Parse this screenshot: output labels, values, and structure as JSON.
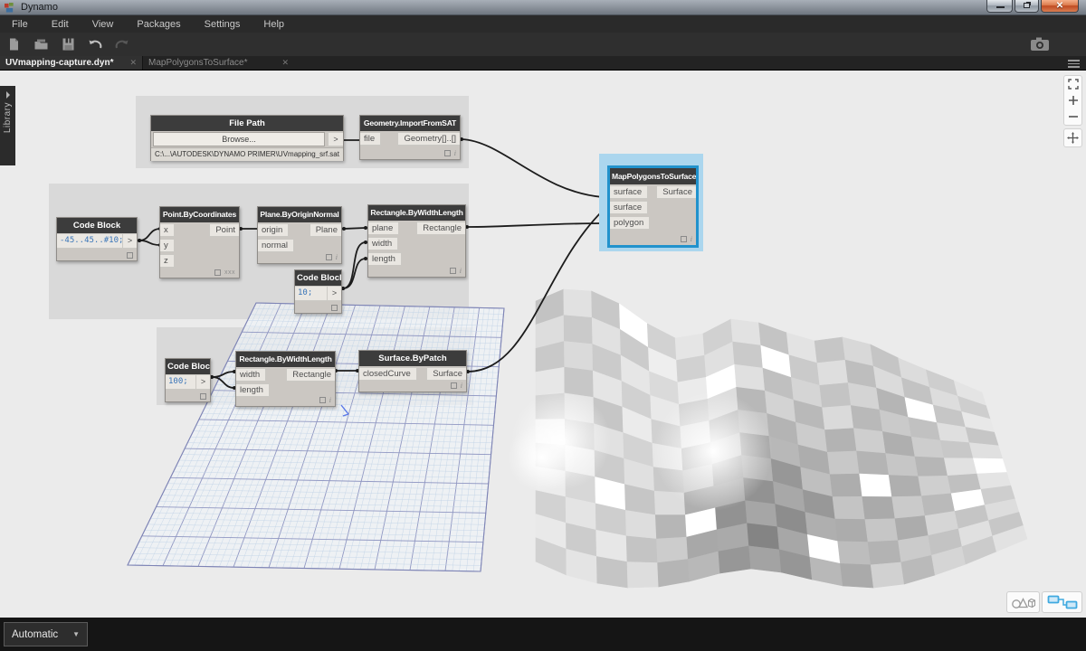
{
  "window": {
    "title": "Dynamo"
  },
  "menu": {
    "items": [
      "File",
      "Edit",
      "View",
      "Packages",
      "Settings",
      "Help"
    ]
  },
  "toolbar": {
    "icons": [
      "new-file",
      "open-file",
      "save",
      "undo",
      "redo"
    ],
    "right_icon": "screenshot-camera"
  },
  "tabs": [
    {
      "label": "UVmapping-capture.dyn*",
      "active": true
    },
    {
      "label": "MapPolygonsToSurface*",
      "active": false
    }
  ],
  "icons": {
    "close": "✕",
    "caret_down": "▼",
    "output_arrow": ">",
    "info": "i"
  },
  "library": {
    "label": "Library"
  },
  "footer": {
    "run_mode": "Automatic"
  },
  "canvas": {
    "nodes": [
      {
        "title": "File Path",
        "button": "Browse...",
        "output": ">",
        "path": "C:\\...\\AUTODESK\\DYNAMO PRIMER\\UVmapping_srf.sat"
      },
      {
        "title": "Geometry.ImportFromSAT",
        "inputs": [
          "file"
        ],
        "outputs": [
          "Geometry[]..[]"
        ]
      },
      {
        "title": "Code Block",
        "code": "-45..45..#10;",
        "output": ">"
      },
      {
        "title": "Point.ByCoordinates",
        "inputs": [
          "x",
          "y",
          "z"
        ],
        "outputs": [
          "Point"
        ],
        "lacing": "xxx"
      },
      {
        "title": "Plane.ByOriginNormal",
        "inputs": [
          "origin",
          "normal"
        ],
        "outputs": [
          "Plane"
        ]
      },
      {
        "title": "Rectangle.ByWidthLength",
        "inputs": [
          "plane",
          "width",
          "length"
        ],
        "outputs": [
          "Rectangle"
        ]
      },
      {
        "title": "Code Block",
        "code": "10;",
        "output": ">"
      },
      {
        "title": "Code Block",
        "code": "100;",
        "output": ">"
      },
      {
        "title": "Rectangle.ByWidthLength",
        "inputs": [
          "width",
          "length"
        ],
        "outputs": [
          "Rectangle"
        ]
      },
      {
        "title": "Surface.ByPatch",
        "inputs": [
          "closedCurve"
        ],
        "outputs": [
          "Surface"
        ]
      },
      {
        "title": "MapPolygonsToSurface",
        "inputs": [
          "surface",
          "surface",
          "polygon"
        ],
        "outputs": [
          "Surface"
        ],
        "selected": true
      }
    ],
    "connections": [
      {
        "from": "File Path.>",
        "to": "Geometry.ImportFromSAT.file"
      },
      {
        "from": "Geometry.ImportFromSAT.Geometry[]..[]",
        "to": "MapPolygonsToSurface.surface"
      },
      {
        "from": "Code Block(-45..45..#10;).>",
        "to": "Point.ByCoordinates.x"
      },
      {
        "from": "Code Block(-45..45..#10;).>",
        "to": "Point.ByCoordinates.y"
      },
      {
        "from": "Point.ByCoordinates.Point",
        "to": "Plane.ByOriginNormal.origin"
      },
      {
        "from": "Plane.ByOriginNormal.Plane",
        "to": "Rectangle.ByWidthLength.plane"
      },
      {
        "from": "Code Block(10;).>",
        "to": "Rectangle.ByWidthLength.width"
      },
      {
        "from": "Code Block(10;).>",
        "to": "Rectangle.ByWidthLength.length"
      },
      {
        "from": "Rectangle.ByWidthLength.Rectangle",
        "to": "MapPolygonsToSurface.polygon"
      },
      {
        "from": "Surface.ByPatch.Surface",
        "to": "MapPolygonsToSurface.surface"
      },
      {
        "from": "Code Block(100;).>",
        "to": "Rectangle.ByWidthLength#2.width"
      },
      {
        "from": "Code Block(100;).>",
        "to": "Rectangle.ByWidthLength#2.length"
      },
      {
        "from": "Rectangle.ByWidthLength#2.Rectangle",
        "to": "Surface.ByPatch.closedCurve"
      }
    ]
  },
  "colors": {
    "selection_border": "#2192CC",
    "selection_halo": "#ABD6EE",
    "wire": "#1C1C1C",
    "node_header": "#3C3C3C",
    "canvas": "#EBEBEB",
    "group": "#D9D9D9",
    "code_text": "#3B76B8",
    "accent_blue": "#3FA9E0",
    "grid_major": "#9097C2",
    "grid_minor": "#C2D4E6"
  }
}
